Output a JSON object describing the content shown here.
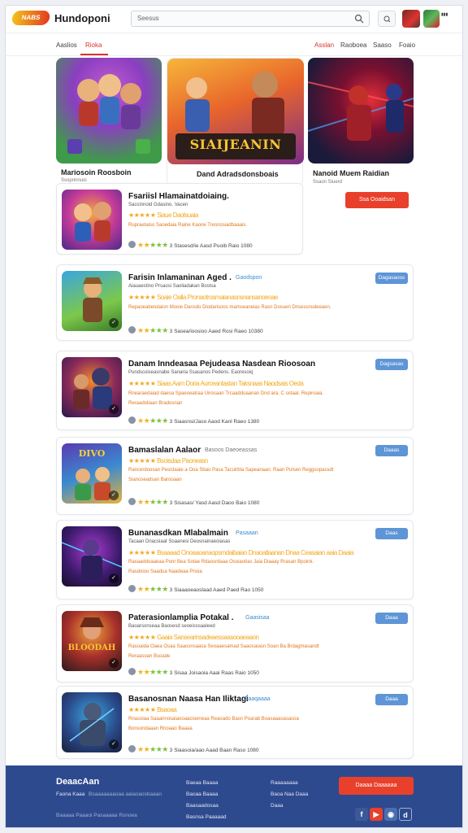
{
  "header": {
    "logo_text": "NABS",
    "site_title": "Hundoponi",
    "search_placeholder": "Seesus"
  },
  "nav": {
    "left": [
      "Aaslios",
      "Rioka"
    ],
    "right": [
      "Asslan",
      "Raoboea",
      "Saaso",
      "Foaio"
    ]
  },
  "featured": [
    {
      "title": "Mariosoin Roosboin",
      "subtitle": "Ssoprinnuoi",
      "banner_text": ""
    },
    {
      "title": "Dand Adradsdonsboais",
      "subtitle": "",
      "banner_text": "SIAIJEANIN"
    },
    {
      "title": "Nanoid Muem Raidian",
      "subtitle": "Ssaon Siuerd",
      "button": "Ssa Ooaidsan"
    }
  ],
  "apps": [
    {
      "title": "Fsariisl Hlamainatdoiaing.",
      "tag": "",
      "line1": "Saccinnoid Gdasino. Vacen",
      "line2": "★★★★★  Siaue   Daolsuaia",
      "line3": "Rupraetaiso  Saoedaia  Raine  Kaone Tresnosiadbaaais.",
      "line4": "",
      "meta": "3  Stasesd/ie   Aasd    Puoib    Raio 1080",
      "button": ""
    },
    {
      "title": "Farisin Inlamaninan Aged .",
      "tag": "Gaodspon",
      "line1": "Aiauaestino Prsaosi Saoliadakan Bostsa",
      "line2": "★★★★★  Soaie Oalia Pronaotrosmaianasnsnansanoeoae",
      "line3": "Repaoeabeodaion Mooie Dansdo Diodarisoos mamseaneias Rasn Dosuen Dnsessnsdeeaen.",
      "line4": "",
      "meta": "3  Sasea/ioosioo   Aaed    Rosi    Raeo 10380",
      "button": "Dagasaoss"
    },
    {
      "title": "Danam Inndeasaa Pejudeasa Nasdean Rioosoan",
      "tag": "",
      "line1": "Pundscoiseasnabe Sanaria Ssasanos Pedens. Eaoresoiq",
      "line2": "★★★★★  Siaas  Aam Doria Aurceantastan Taksnaas Naodsais Oeda",
      "line3": "Rnearaedaiad  daeoa Spaeoeatraa Uirosaan Trcaaddoaanan Dnd ara. C ostaal. Repiroaia.",
      "line4": "Reraadoliaan  Bradosnan",
      "meta": "3  Siaasnsi/Jaso   Aaod    Kanl    Raeo 1380",
      "button": "Dagsasas"
    },
    {
      "title": "Bamaslalan Aalaor",
      "tag": "Basoos  Daeoeassas",
      "line1": "★★★★★  Bsoisdaa  Paoneasn",
      "line2": "Rancerdoosan  Pesrdaaie a  Ooa  Sbao Pasa Tacuirbla Sapeanaan. Raan  Pulsen  Reggsopassdt",
      "line3": "Sianoseadsan  Barooaan",
      "line4": "",
      "meta": "3  Sisasas/ Yasd   Aasd    Daoo    Baio 1080",
      "button": "Daaas"
    },
    {
      "title": "Bunanasdkan Mlabalmain",
      "tag": "Pasaaan",
      "line1": "Tacaan Dnacsiaat Soaanesi Deosnainaeoiasas",
      "line2": "★★★★★  Bsaaaad Onoaaoanaopsmdaibaian Dnaoatlaanan Dnaa Ceasaian aaia  Daaia",
      "line3": "Rasaaddoaaeaa  Ponr  Bea  Sotae  Rdaosrdaaa Osoiaoitas Jaia  Diaaay  Rrasan  Bpoink.",
      "line4": "Rasdoioo   Saadua  Naadeaa  Pnoia",
      "meta": "3  Siaaaoeaoslaad    Aaed    Paed    Rao 1050",
      "button": "Daas"
    },
    {
      "title": "Paterasionlamplia Potakal .",
      "tag": "Gaasisaa",
      "line1": "Baoarsonseaa  Baosesd seoeisssaaleed",
      "line2": "★★★★★  Gaaia  Sansearinsadeaessaasooaeaaon",
      "line3": "Rasoaida  Oaea  Osaa Saaosnsaasa Seoaaesamad  Saaosaiasn Soan Ba  Brdagmasandt",
      "line4": "Reraasoan  Bsoade",
      "meta": "3  Sisaa Joisaoia   Aaai    Raas    Raio 1050",
      "button": "Daaa"
    },
    {
      "title": "Basanosnan Naasa Han Iliktagi",
      "tag": "Gaaqaaaa",
      "line1": "★★★★★  Bsaoaa",
      "line2": "Rnasoiaa Saaannosaiaooaacioeneaa  Reaoado Basn Poarab  Boasaaasasasoa",
      "line3": "Bonsondaaan  Rnoaao  Baaaa",
      "line4": "",
      "meta": "3  Siaasoia/aao   Aaad    Baan    Raso 1080",
      "button": "Daaa"
    }
  ],
  "footer": {
    "brand": "DeaacAan",
    "col1": [
      "Faona Kaaa",
      "Bsaaaaaaaoaa aaiaoaosbaaan",
      "Baaaaa Paaaoi Pasaaaaa Rsnoea"
    ],
    "col2": [
      "Baeaa Baaaa",
      "Baoaa Baaaa",
      "Baasaadosaa",
      "Basnsa Paaaaad"
    ],
    "col3": [
      "Raaaaaaaa",
      "Baoa Naa Daaa",
      "Daaa"
    ],
    "cta": "Daaaa Daaaaaa",
    "colors": {
      "bg": "#2e4a8f",
      "cta": "#e8402b"
    }
  }
}
